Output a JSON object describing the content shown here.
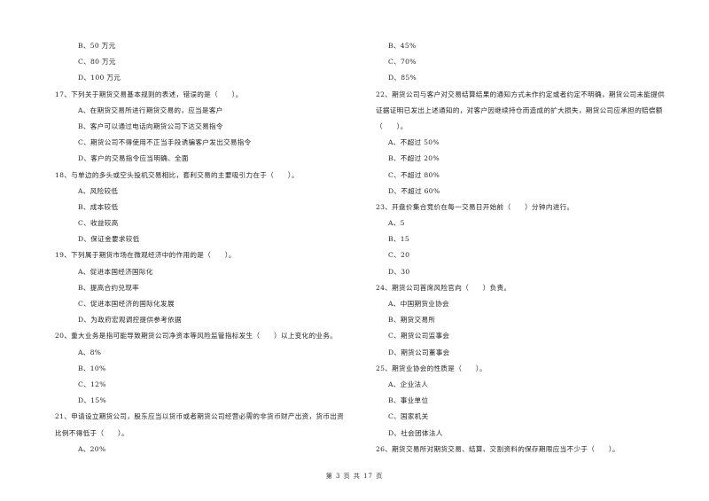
{
  "left_column": [
    {
      "type": "option",
      "text": "B、50 万元"
    },
    {
      "type": "option",
      "text": "C、80 万元"
    },
    {
      "type": "option",
      "text": "D、100 万元"
    },
    {
      "type": "question",
      "text": "17、下列关于期货交易基本规则的表述，错误的是（　　）。"
    },
    {
      "type": "option",
      "text": "A、在期货交易所进行期货交易的，应当是客户"
    },
    {
      "type": "option",
      "text": "B、客户可以通过电话向期货公司下达交易指令"
    },
    {
      "type": "option",
      "text": "C、期货公司不得使用不正当手段诱骗客户发出交易指令"
    },
    {
      "type": "option",
      "text": "D、客户的交易指令应当明确、全面"
    },
    {
      "type": "question",
      "text": "18、与单边的多头或空头投机交易相比，套利交易的主要吸引力在于（　　）。"
    },
    {
      "type": "option",
      "text": "A、风险较低"
    },
    {
      "type": "option",
      "text": "B、成本较低"
    },
    {
      "type": "option",
      "text": "C、收益较高"
    },
    {
      "type": "option",
      "text": "D、保证金要求较低"
    },
    {
      "type": "question",
      "text": "19、下列属于期货市场在微观经济中的作用的是（　　）。"
    },
    {
      "type": "option",
      "text": "A、促进本国经济国际化"
    },
    {
      "type": "option",
      "text": "B、提高合约兑现率"
    },
    {
      "type": "option",
      "text": "C、促进本国经济的国际化发展"
    },
    {
      "type": "option",
      "text": "D、为政府宏观调控提供参考依据"
    },
    {
      "type": "question",
      "text": "20、重大业务是指可能导致期货公司净资本等风险监管指标发生（　　）以上变化的业务。"
    },
    {
      "type": "option",
      "text": "A、8%"
    },
    {
      "type": "option",
      "text": "B、10%"
    },
    {
      "type": "option",
      "text": "C、12%"
    },
    {
      "type": "option",
      "text": "D、15%"
    },
    {
      "type": "question",
      "text": "21、申请设立期货公司，股东应当以货币或者期货公司经营必需的非货币财产出资，货币出资"
    },
    {
      "type": "continuation",
      "text": "比例不得低于（　　）。"
    },
    {
      "type": "option",
      "text": "A、20%"
    }
  ],
  "right_column": [
    {
      "type": "option",
      "text": "B、45%"
    },
    {
      "type": "option",
      "text": "C、70%"
    },
    {
      "type": "option",
      "text": "D、85%"
    },
    {
      "type": "question",
      "text": "22、期货公司与客户对交易结算结果的通知方式未作约定或者约定不明确，期货公司未能提供"
    },
    {
      "type": "continuation",
      "text": "证据证明已发出上述通知的，对客户因继续持仓而造成的扩大损失，期货公司应承担的赔偿额"
    },
    {
      "type": "continuation",
      "text": "（　　）。"
    },
    {
      "type": "option",
      "text": "A、不超过 50%"
    },
    {
      "type": "option",
      "text": "B、不超过 20%"
    },
    {
      "type": "option",
      "text": "C、不超过 80%"
    },
    {
      "type": "option",
      "text": "D、不超过 60%"
    },
    {
      "type": "question",
      "text": "23、开盘价集合竞价在每一交易日开始前（　　）分钟内进行。"
    },
    {
      "type": "option",
      "text": "A、5"
    },
    {
      "type": "option",
      "text": "B、15"
    },
    {
      "type": "option",
      "text": "C、20"
    },
    {
      "type": "option",
      "text": "D、30"
    },
    {
      "type": "question",
      "text": "24、期货公司首席风险官向（　　）负责。"
    },
    {
      "type": "option",
      "text": "A、中国期货业协会"
    },
    {
      "type": "option",
      "text": "B、期货交易所"
    },
    {
      "type": "option",
      "text": "C、期货公司监事会"
    },
    {
      "type": "option",
      "text": "D、期货公司董事会"
    },
    {
      "type": "question",
      "text": "25、期货业协会的性质是（　　）。"
    },
    {
      "type": "option",
      "text": "A、企业法人"
    },
    {
      "type": "option",
      "text": "B、事业单位"
    },
    {
      "type": "option",
      "text": "C、国家机关"
    },
    {
      "type": "option",
      "text": "D、社会团体法人"
    },
    {
      "type": "question",
      "text": "26、期货交易所对期货交易、结算、交割资料的保存期限应当不少于（　　）。"
    }
  ],
  "footer": {
    "page_label": "第 3 页 共 17 页"
  }
}
